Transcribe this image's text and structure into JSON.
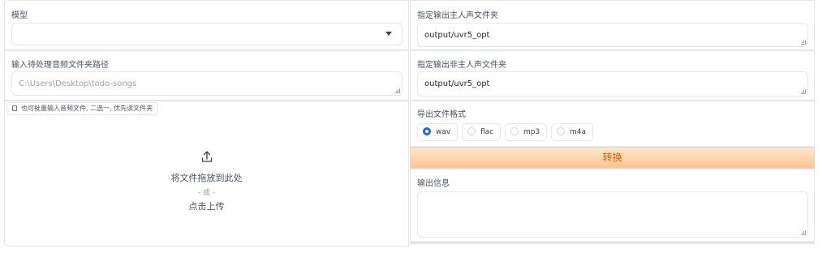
{
  "model": {
    "label": "模型",
    "selected": ""
  },
  "input_path": {
    "label": "输入待处理音频文件夹路径",
    "placeholder": "C:\\Users\\Desktop\\todo-songs"
  },
  "upload": {
    "tip": "也可批量输入音频文件, 二选一, 优先读文件夹",
    "drop_text": "将文件拖放到此处",
    "or_text": "- 或 -",
    "click_text": "点击上传"
  },
  "vocal_output": {
    "label": "指定输出主人声文件夹",
    "value": "output/uvr5_opt"
  },
  "instrumental_output": {
    "label": "指定输出非主人声文件夹",
    "value": "output/uvr5_opt"
  },
  "format": {
    "label": "导出文件格式",
    "options": [
      "wav",
      "flac",
      "mp3",
      "m4a"
    ],
    "selected": "wav"
  },
  "convert_button": "转换",
  "output_info": {
    "label": "输出信息",
    "value": ""
  },
  "colors": {
    "accent": "#2563eb",
    "button_text": "#ea580c",
    "button_bg": "#fdc48c"
  }
}
